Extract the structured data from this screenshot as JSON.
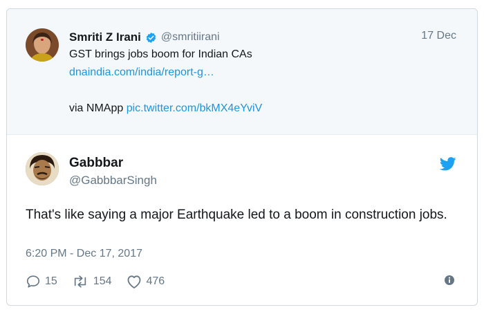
{
  "quoted_tweet": {
    "author_name": "Smriti Z Irani",
    "author_handle": "@smritiirani",
    "date": "17 Dec",
    "text": "GST brings jobs boom for Indian CAs",
    "link": "dnaindia.com/india/report-g…",
    "via_prefix": "via NMApp",
    "pic_link": "pic.twitter.com/bkMX4eYviV"
  },
  "tweet": {
    "author_name": "Gabbbar",
    "author_handle": "@GabbbarSingh",
    "text": "That's like saying a major Earthquake led to a boom in construction jobs.",
    "timestamp": "6:20 PM - Dec 17, 2017",
    "replies": "15",
    "retweets": "154",
    "likes": "476"
  },
  "icons": {
    "verified": "verified-badge-icon",
    "brand": "twitter-bird-icon",
    "reply": "reply-icon",
    "retweet": "retweet-icon",
    "like": "heart-icon",
    "info": "info-icon"
  },
  "colors": {
    "link": "#1b95e0",
    "muted": "#657786",
    "quote_bg": "#f5f8fa"
  }
}
